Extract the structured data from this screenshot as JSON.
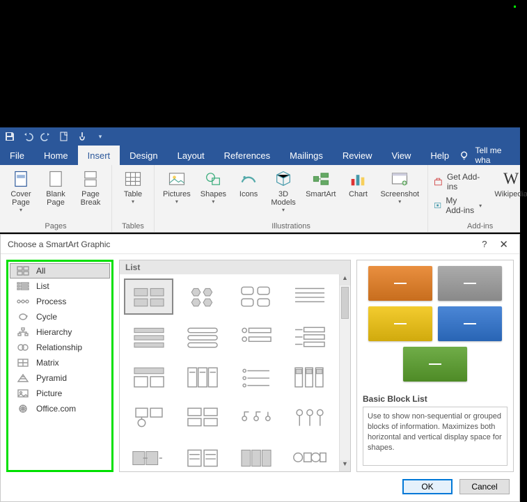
{
  "titlebar": {
    "icons": [
      "save-icon",
      "undo-icon",
      "redo-icon",
      "newdoc-icon",
      "touch-icon",
      "customize-icon"
    ]
  },
  "tabs": [
    {
      "id": "file",
      "label": "File"
    },
    {
      "id": "home",
      "label": "Home"
    },
    {
      "id": "insert",
      "label": "Insert",
      "active": true
    },
    {
      "id": "design",
      "label": "Design"
    },
    {
      "id": "layout",
      "label": "Layout"
    },
    {
      "id": "references",
      "label": "References"
    },
    {
      "id": "mailings",
      "label": "Mailings"
    },
    {
      "id": "review",
      "label": "Review"
    },
    {
      "id": "view",
      "label": "View"
    },
    {
      "id": "help",
      "label": "Help"
    }
  ],
  "tell_me": "Tell me wha",
  "ribbon": {
    "groups": {
      "pages": {
        "label": "Pages",
        "items": [
          {
            "id": "cover-page",
            "label": "Cover\nPage",
            "caret": true
          },
          {
            "id": "blank-page",
            "label": "Blank\nPage"
          },
          {
            "id": "page-break",
            "label": "Page\nBreak"
          }
        ]
      },
      "tables": {
        "label": "Tables",
        "items": [
          {
            "id": "table",
            "label": "Table",
            "caret": true
          }
        ]
      },
      "illustrations": {
        "label": "Illustrations",
        "items": [
          {
            "id": "pictures",
            "label": "Pictures",
            "caret": true
          },
          {
            "id": "shapes",
            "label": "Shapes",
            "caret": true
          },
          {
            "id": "icons",
            "label": "Icons"
          },
          {
            "id": "3d-models",
            "label": "3D\nModels",
            "caret": true
          },
          {
            "id": "smartart",
            "label": "SmartArt"
          },
          {
            "id": "chart",
            "label": "Chart"
          },
          {
            "id": "screenshot",
            "label": "Screenshot",
            "caret": true
          }
        ]
      },
      "addins": {
        "label": "Add-ins",
        "get": "Get Add-ins",
        "my": "My Add-ins",
        "wikipedia": "Wikipedia"
      }
    }
  },
  "dialog": {
    "title": "Choose a SmartArt Graphic",
    "categories": [
      {
        "id": "all",
        "label": "All",
        "selected": true
      },
      {
        "id": "list",
        "label": "List"
      },
      {
        "id": "process",
        "label": "Process"
      },
      {
        "id": "cycle",
        "label": "Cycle"
      },
      {
        "id": "hierarchy",
        "label": "Hierarchy"
      },
      {
        "id": "relationship",
        "label": "Relationship"
      },
      {
        "id": "matrix",
        "label": "Matrix"
      },
      {
        "id": "pyramid",
        "label": "Pyramid"
      },
      {
        "id": "picture",
        "label": "Picture"
      },
      {
        "id": "officecom",
        "label": "Office.com"
      }
    ],
    "gallery_heading": "List",
    "preview": {
      "name": "Basic Block List",
      "colors": [
        "#e67e22",
        "#9e9e9e",
        "#f1c40f",
        "#2f74d0",
        "#5aa02c"
      ],
      "description": "Use to show non-sequential or grouped blocks of information. Maximizes both horizontal and vertical display space for shapes."
    },
    "buttons": {
      "ok": "OK",
      "cancel": "Cancel"
    }
  }
}
